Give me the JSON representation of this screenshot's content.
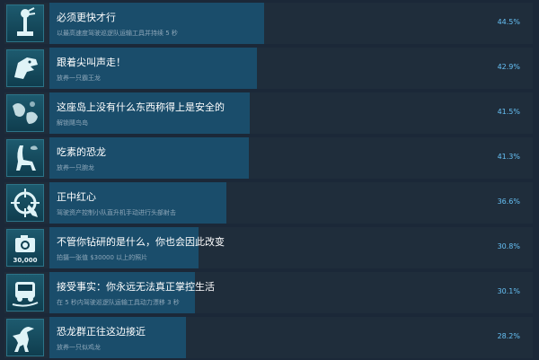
{
  "achievements": [
    {
      "title": "必须更快才行",
      "desc": "以最高速度驾驶巡逻队运输工具并持续 5 秒",
      "percent_label": "44.5%",
      "percent": 44.5,
      "icon": "joystick-icon"
    },
    {
      "title": "跟着尖叫声走！",
      "desc": "放养一只霸王龙",
      "percent_label": "42.9%",
      "percent": 42.9,
      "icon": "trex-head-icon"
    },
    {
      "title": "这座岛上没有什么东西称得上是安全的",
      "desc": "解锁飓鸟岛",
      "percent_label": "41.5%",
      "percent": 41.5,
      "icon": "island-map-icon"
    },
    {
      "title": "吃素的恐龙",
      "desc": "放养一只腕龙",
      "percent_label": "41.3%",
      "percent": 41.3,
      "icon": "brachiosaurus-icon"
    },
    {
      "title": "正中红心",
      "desc": "驾驶资产控制小队直升机手动进行头部射击",
      "percent_label": "36.6%",
      "percent": 36.6,
      "icon": "crosshair-icon"
    },
    {
      "title": "不管你钻研的是什么，你也会因此改变",
      "desc": "拍摄一张值 $30000 以上的照片",
      "percent_label": "30.8%",
      "percent": 30.8,
      "icon": "camera-icon",
      "caption": "30,000"
    },
    {
      "title": "接受事实：你永远无法真正掌控生活",
      "desc": "在 5 秒内驾驶巡逻队运输工具动力漂移 3 秒",
      "percent_label": "30.1%",
      "percent": 30.1,
      "icon": "drift-car-icon"
    },
    {
      "title": "恐龙群正往这边接近",
      "desc": "放养一只似鸡龙",
      "percent_label": "28.2%",
      "percent": 28.2,
      "icon": "gallimimus-icon"
    }
  ]
}
